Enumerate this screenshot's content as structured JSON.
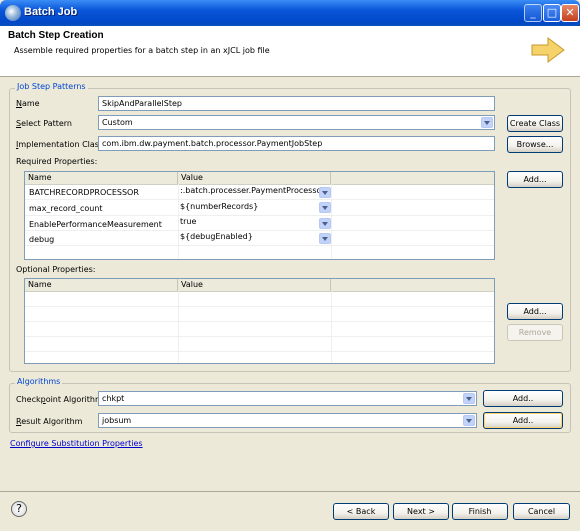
{
  "window": {
    "title": "Batch Job",
    "controls": {
      "minimize": "_",
      "maximize": "□",
      "close": "✕"
    }
  },
  "banner": {
    "title": "Batch Step Creation",
    "description": "Assemble required properties for a batch step in an xJCL job file",
    "icon": "wizard-arrow-icon"
  },
  "job_step": {
    "group_label": "Job Step Patterns",
    "name_label": "Name",
    "name_value": "SkipAndParallelStep",
    "pattern_label": "Select Pattern",
    "pattern_value": "Custom",
    "create_class_label": "Create Class",
    "impl_label": "Implementation Class",
    "impl_value": "com.ibm.dw.payment.batch.processor.PaymentJobStep",
    "browse_label": "Browse...",
    "required_label": "Required Properties:",
    "required_columns": [
      "Name",
      "Value"
    ],
    "required_rows": [
      {
        "name": "BATCHRECORDPROCESSOR",
        "value": ":.batch.processer.PaymentProcessor"
      },
      {
        "name": "max_record_count",
        "value": "${numberRecords}"
      },
      {
        "name": "EnablePerformanceMeasurement",
        "value": "true"
      },
      {
        "name": "debug",
        "value": "${debugEnabled}"
      }
    ],
    "required_add_label": "Add...",
    "optional_label": "Optional Properties:",
    "optional_columns": [
      "Name",
      "Value"
    ],
    "optional_add_label": "Add...",
    "optional_remove_label": "Remove"
  },
  "algorithms": {
    "group_label": "Algorithms",
    "checkpoint_label": "Checkpoint Algorithm",
    "checkpoint_value": "chkpt",
    "checkpoint_add_label": "Add..",
    "result_label": "Result Algorithm",
    "result_value": "jobsum",
    "result_add_label": "Add.."
  },
  "config_link": "Configure Substitution Properties",
  "footer": {
    "help": "?",
    "back_label": "< Back",
    "next_label": "Next >",
    "finish_label": "Finish",
    "cancel_label": "Cancel"
  },
  "colors": {
    "titlebar": "#0a55d8",
    "group_label": "#0046d5",
    "link": "#0000cc"
  }
}
